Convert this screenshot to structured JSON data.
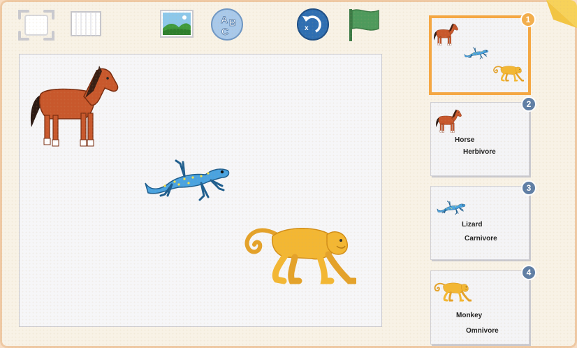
{
  "toolbar": {
    "buttons": [
      {
        "name": "fullscreen-button",
        "icon": "fullscreen-icon"
      },
      {
        "name": "grid-button",
        "icon": "grid-icon"
      },
      {
        "name": "add-background-button",
        "icon": "image-icon"
      },
      {
        "name": "add-text-button",
        "icon": "abc-icon"
      },
      {
        "name": "undo-button",
        "icon": "undo-icon"
      },
      {
        "name": "green-flag-button",
        "icon": "flag-icon"
      }
    ]
  },
  "canvas": {
    "sprites": [
      {
        "name": "horse",
        "icon": "horse-icon"
      },
      {
        "name": "lizard",
        "icon": "lizard-icon"
      },
      {
        "name": "monkey",
        "icon": "monkey-icon"
      }
    ]
  },
  "pages": [
    {
      "number": "1",
      "selected": true,
      "title": "",
      "subtitle": ""
    },
    {
      "number": "2",
      "selected": false,
      "title": "Horse",
      "subtitle": "Herbivore"
    },
    {
      "number": "3",
      "selected": false,
      "title": "Lizard",
      "subtitle": "Carnivore"
    },
    {
      "number": "4",
      "selected": false,
      "title": "Monkey",
      "subtitle": "Omnivore"
    }
  ],
  "colors": {
    "selected_page_border": "#f5a742",
    "page_badge_blue": "#5f7ea5",
    "page_badge_orange": "#f3ae4c",
    "flag_green": "#4e9a5c",
    "undo_blue": "#2f6fb2",
    "horse": "#c8582c",
    "lizard": "#4aa3e0",
    "monkey": "#f3b733"
  }
}
